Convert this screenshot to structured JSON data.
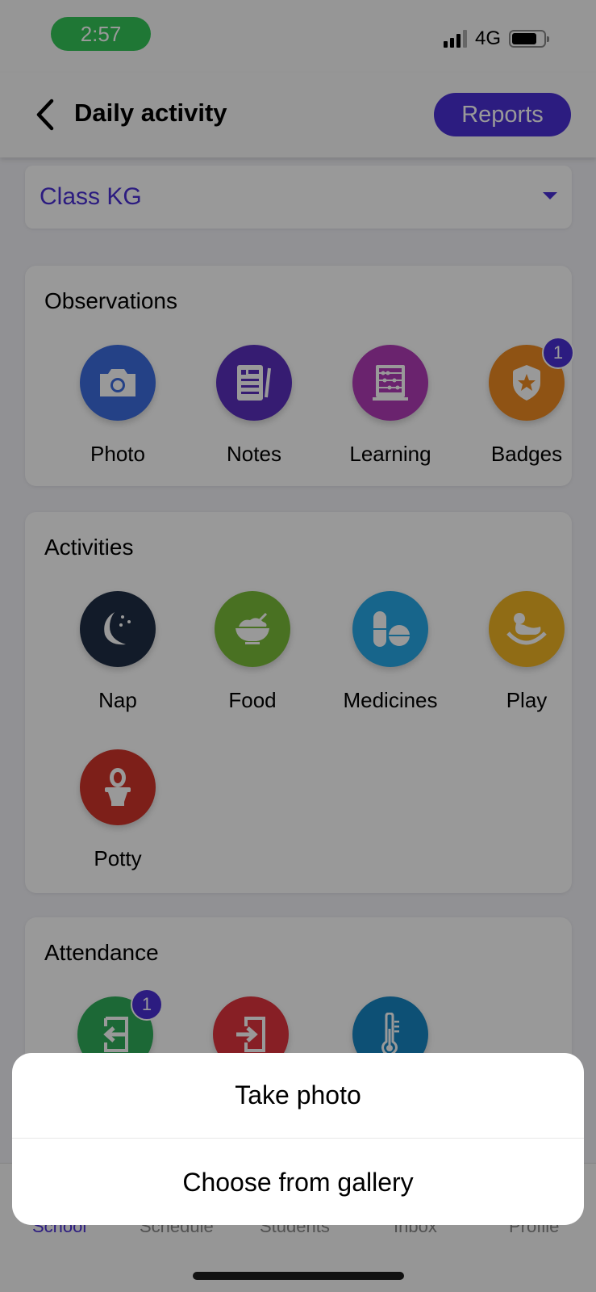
{
  "status_bar": {
    "time": "2:57",
    "network": "4G",
    "battery_level_fraction": 0.8,
    "signal_bars": 3,
    "signal_total": 4
  },
  "header": {
    "title": "Daily activity",
    "reports_label": "Reports"
  },
  "class_select": {
    "value": "Class KG"
  },
  "observations": {
    "title": "Observations",
    "items": [
      {
        "label": "Photo",
        "icon": "camera-icon",
        "color": "#3d6de0"
      },
      {
        "label": "Notes",
        "icon": "notes-icon",
        "color": "#5b2fbf"
      },
      {
        "label": "Learning",
        "icon": "abacus-icon",
        "color": "#b13bb7"
      },
      {
        "label": "Badges",
        "icon": "badge-shield-icon",
        "color": "#ef8a22",
        "badge": "1"
      }
    ]
  },
  "activities": {
    "title": "Activities",
    "items": [
      {
        "label": "Nap",
        "icon": "moon-icon",
        "color": "#1f2d45"
      },
      {
        "label": "Food",
        "icon": "food-bowl-icon",
        "color": "#7bbd3a"
      },
      {
        "label": "Medicines",
        "icon": "pills-icon",
        "color": "#27a8e8"
      },
      {
        "label": "Play",
        "icon": "rocking-horse-icon",
        "color": "#f0b423"
      },
      {
        "label": "Potty",
        "icon": "toilet-icon",
        "color": "#d0342a"
      }
    ]
  },
  "attendance": {
    "title": "Attendance",
    "items": [
      {
        "icon": "check-in-icon",
        "color": "#2fae5a",
        "badge": "1"
      },
      {
        "icon": "check-out-icon",
        "color": "#e2343f"
      },
      {
        "icon": "thermometer-icon",
        "color": "#1786c4"
      }
    ]
  },
  "tab_bar": {
    "tabs": [
      "School",
      "Schedule",
      "Students",
      "Inbox",
      "Profile"
    ],
    "active": "School"
  },
  "action_sheet": {
    "options": [
      "Take photo",
      "Choose from gallery"
    ]
  },
  "colors": {
    "accent": "#4a2fd6",
    "status_pill": "#34c759"
  }
}
